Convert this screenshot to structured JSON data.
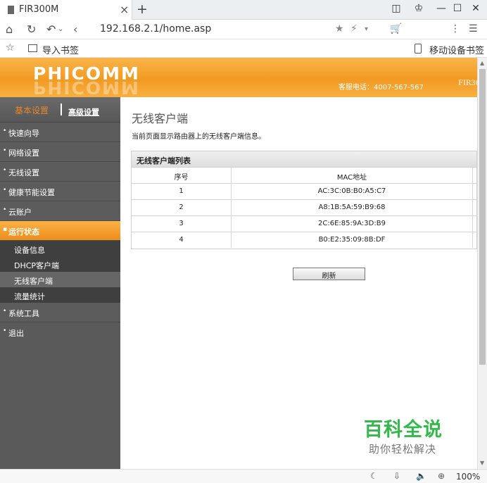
{
  "browser": {
    "tab_title": "FIR300M",
    "tab_close": "×",
    "new_tab": "+",
    "url": "192.168.2.1/home.asp",
    "bookmark_import": "导入书签",
    "mobile_bookmarks": "移动设备书签",
    "zoom": "100%"
  },
  "header": {
    "logo": "PHICOMM",
    "hotline": "客服电话：4007-567-567",
    "model": "FIR30"
  },
  "sidebar": {
    "basic": "基本设置",
    "advanced": "高级设置",
    "items": [
      {
        "label": "快速向导"
      },
      {
        "label": "网络设置"
      },
      {
        "label": "无线设置"
      },
      {
        "label": "健康节能设置"
      },
      {
        "label": "云账户"
      },
      {
        "label": "运行状态"
      },
      {
        "label": "系统工具"
      },
      {
        "label": "退出"
      }
    ],
    "sub_items": [
      {
        "label": "设备信息"
      },
      {
        "label": "DHCP客户端"
      },
      {
        "label": "无线客户端"
      },
      {
        "label": "流量统计"
      }
    ]
  },
  "content": {
    "title": "无线客户端",
    "description": "当前页面显示路由器上的无线客户端信息。",
    "table_caption": "无线客户端列表",
    "col_index": "序号",
    "col_mac": "MAC地址",
    "rows": [
      {
        "index": "1",
        "mac": "AC:3C:0B:B0:A5:C7"
      },
      {
        "index": "2",
        "mac": "A8:1B:5A:59:B9:68"
      },
      {
        "index": "3",
        "mac": "2C:6E:85:9A:3D:B9"
      },
      {
        "index": "4",
        "mac": "B0:E2:35:09:8B:DF"
      }
    ],
    "refresh": "刷新"
  },
  "watermark": {
    "big": "百科全说",
    "small": "助你轻松解决"
  }
}
